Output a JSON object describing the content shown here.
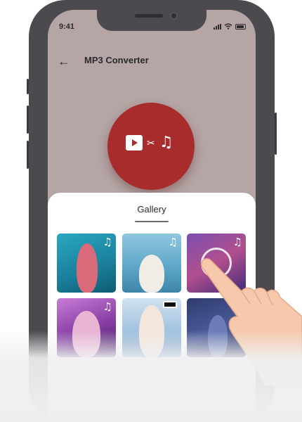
{
  "status_bar": {
    "time": "9:41"
  },
  "header": {
    "title": "MP3 Converter",
    "back_icon": "back-arrow-icon"
  },
  "converter": {
    "icons": [
      "video-play-icon",
      "scissors-icon",
      "music-note-icon"
    ],
    "accent_color": "#a82c2c"
  },
  "gallery": {
    "title": "Gallery",
    "items": [
      {
        "icon": "music-note-icon",
        "has_note": true
      },
      {
        "icon": "music-note-icon",
        "has_note": true
      },
      {
        "icon": "music-note-icon",
        "has_note": true
      },
      {
        "icon": "music-note-icon",
        "has_note": true
      },
      {
        "icon": "explicit-label-icon",
        "has_note": false
      },
      {
        "icon": "",
        "has_note": false
      }
    ]
  },
  "note_glyph": "♫",
  "scissors_glyph": "✂",
  "back_glyph": "←"
}
